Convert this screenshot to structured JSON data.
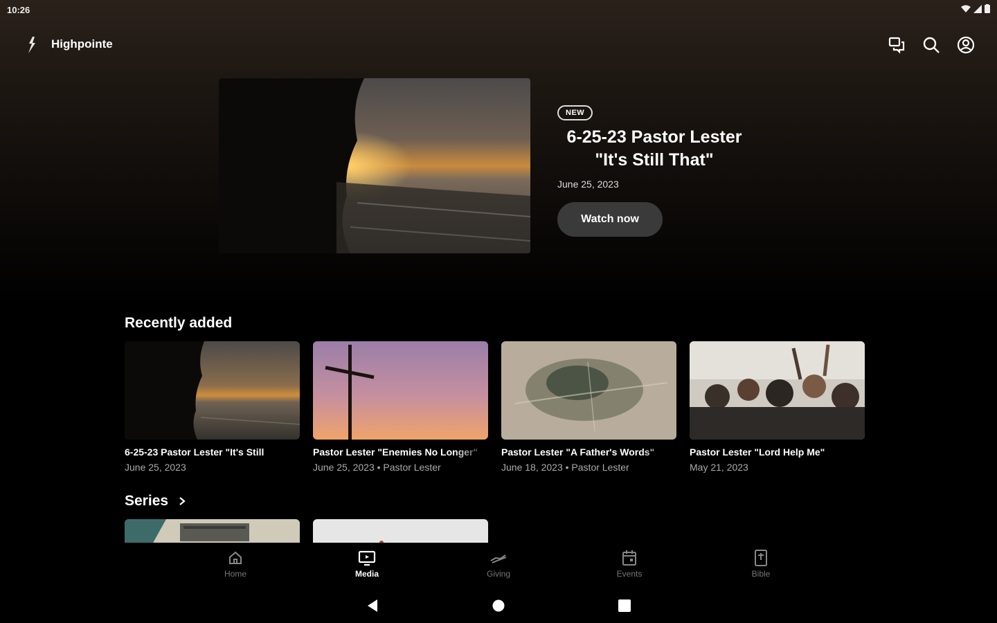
{
  "status_bar": {
    "time": "10:26",
    "icons": [
      "wifi-icon",
      "cell-signal-icon",
      "battery-icon"
    ]
  },
  "app_bar": {
    "title": "Highpointe",
    "actions": [
      "chat-icon",
      "search-icon",
      "account-icon"
    ]
  },
  "hero": {
    "badge": "NEW",
    "title": "6-25-23 Pastor Lester \"It's Still That\"",
    "date": "June 25, 2023",
    "watch_label": "Watch now"
  },
  "recently_added": {
    "title": "Recently added",
    "items": [
      {
        "title": "6-25-23 Pastor Lester \"It's Still",
        "subtitle": "June 25, 2023"
      },
      {
        "title": "Pastor Lester \"Enemies No Longer\"",
        "subtitle": "June 25, 2023 • Pastor Lester"
      },
      {
        "title": "Pastor Lester \"A Father's Words\"",
        "subtitle": "June 18, 2023 • Pastor Lester"
      },
      {
        "title": "Pastor Lester \"Lord Help Me\"",
        "subtitle": "May 21, 2023"
      }
    ]
  },
  "series": {
    "title": "Series",
    "chevron": "chevron-right-icon"
  },
  "bottom_nav": {
    "active": "Media",
    "items": [
      {
        "label": "Home",
        "icon": "home-icon"
      },
      {
        "label": "Media",
        "icon": "tv-icon"
      },
      {
        "label": "Giving",
        "icon": "giving-icon"
      },
      {
        "label": "Events",
        "icon": "calendar-icon"
      },
      {
        "label": "Bible",
        "icon": "bible-icon"
      }
    ]
  },
  "system_nav": [
    "back-icon",
    "home-circle-icon",
    "recents-icon"
  ],
  "colors": {
    "background": "#000000",
    "accent_button": "#3a3a3a",
    "muted_text": "#aaaaaa"
  }
}
